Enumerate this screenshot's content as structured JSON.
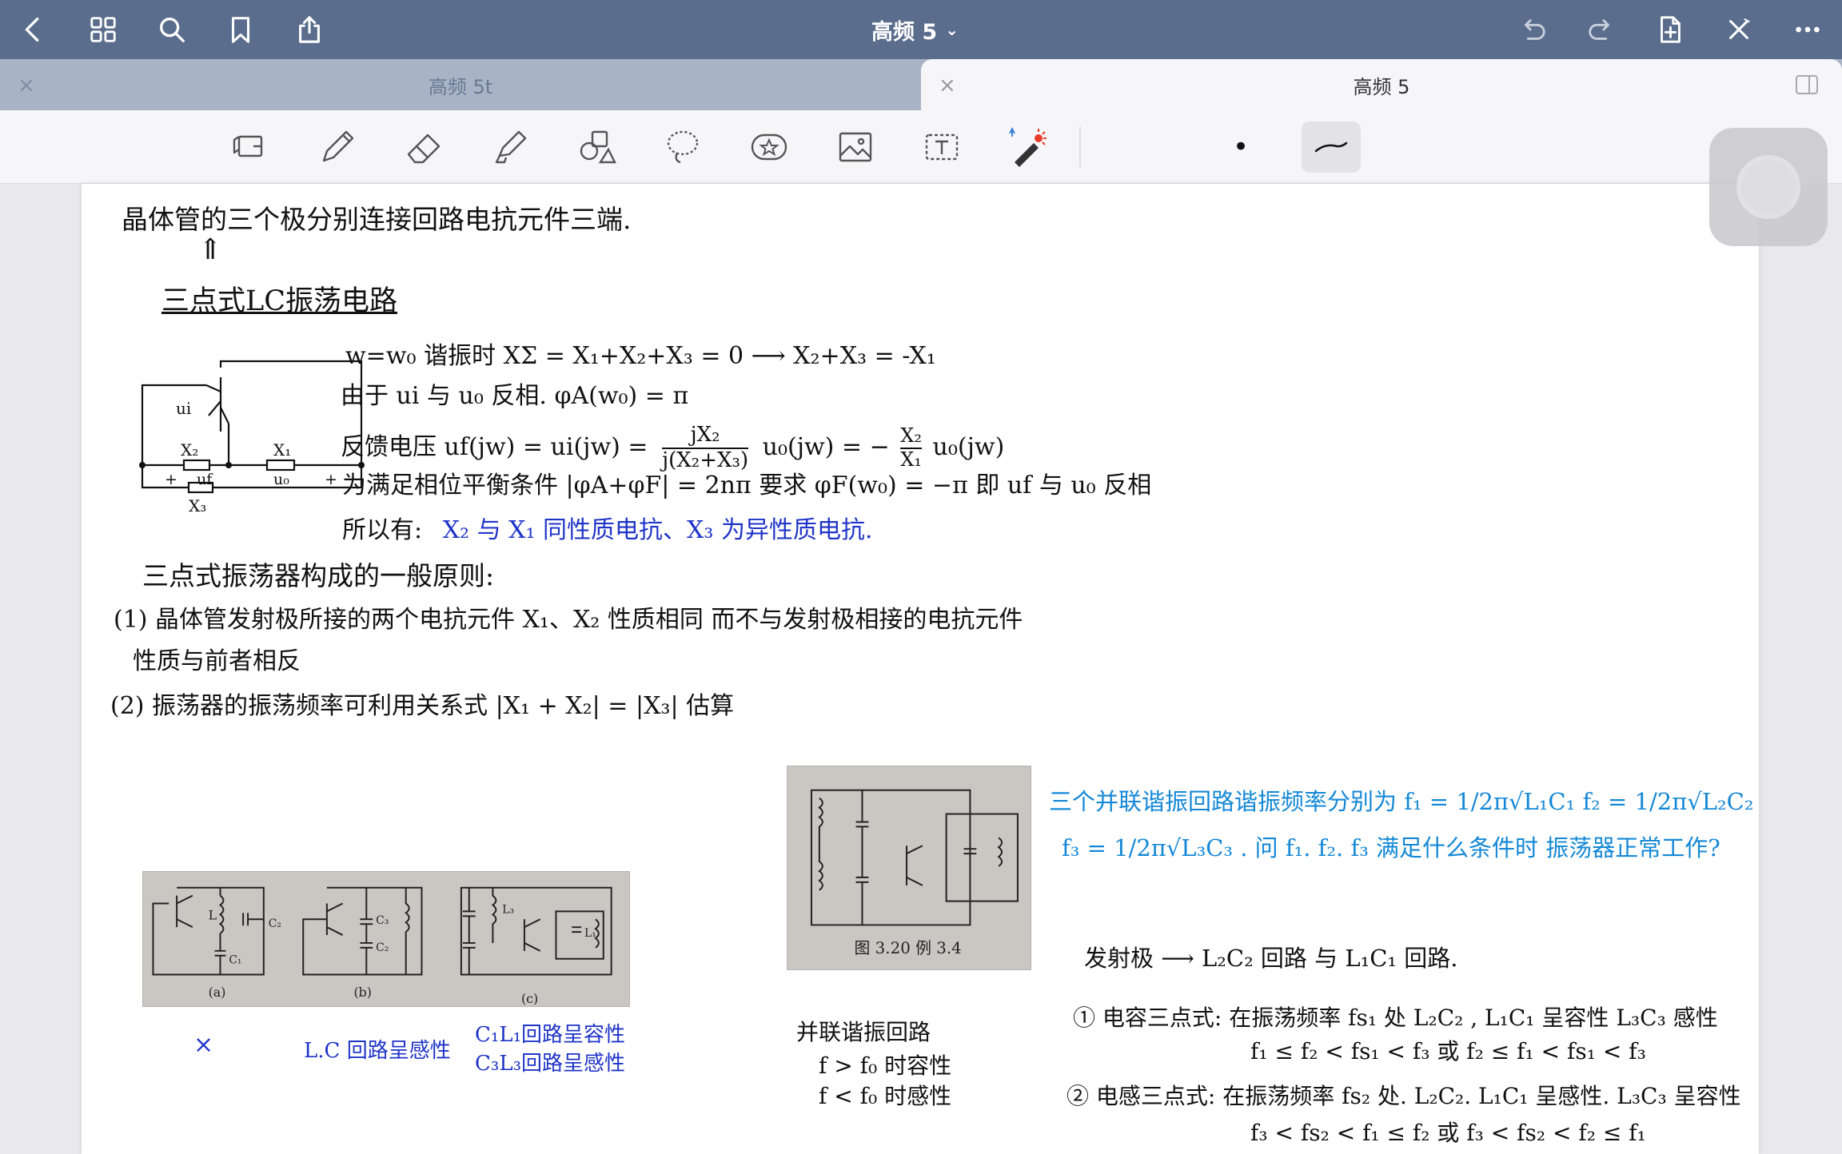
{
  "nav": {
    "title": "高频 5",
    "icons": [
      "back-icon",
      "grid-icon",
      "search-icon",
      "bookmark-icon",
      "share-icon",
      "undo-icon",
      "redo-icon",
      "add-page-icon",
      "close-icon",
      "more-icon"
    ]
  },
  "tabs": [
    {
      "label": "高频 5t",
      "active": false
    },
    {
      "label": "高频 5",
      "active": true
    }
  ],
  "toolbar": {
    "tools": [
      "read-mode",
      "pen",
      "eraser",
      "highlighter",
      "shapes",
      "lasso",
      "sticker",
      "image",
      "text",
      "laser-pointer"
    ],
    "pen_size_dot": "•"
  },
  "notes": {
    "line1": "晶体管的三个极分别连接回路电抗元件三端.",
    "arrow": "⇑",
    "heading1": "三点式LC振荡电路",
    "eq1": "w=w₀ 谐振时 XΣ = X₁+X₂+X₃ = 0  ⟶  X₂+X₃ = -X₁",
    "eq2": "由于 ui 与 u₀ 反相. φA(w₀) = π",
    "eq3_a": "反馈电压  uf(jw) = ui(jw) =",
    "eq3_frac_num": "jX₂",
    "eq3_frac_den": "j(X₂+X₃)",
    "eq3_b": "u₀(jw) = −",
    "eq3_frac2_num": "X₂",
    "eq3_frac2_den": "X₁",
    "eq3_c": "u₀(jw)",
    "eq4": "为满足相位平衡条件 |φA+φF| = 2nπ  要求 φF(w₀) = −π  即 uf 与 u₀ 反相",
    "eq5_a": "所以有:",
    "eq5_b": "X₂ 与 X₁ 同性质电抗、X₃ 为异性质电抗.",
    "heading2": "三点式振荡器构成的一般原则:",
    "rule1a": "(1) 晶体管发射极所接的两个电抗元件 X₁、X₂ 性质相同  而不与发射极相接的电抗元件",
    "rule1b": "性质与前者相反",
    "rule2": "(2) 振荡器的振荡频率可利用关系式  |X₁ + X₂| = |X₃|  估算",
    "circuit_labels": {
      "ui": "ui",
      "x2": "X₂",
      "x1": "X₁",
      "x3": "X₃",
      "uf": "uf",
      "u0": "u₀"
    },
    "fig_captions": [
      "(a)",
      "(b)",
      "(c)"
    ],
    "fig_label_L": "L",
    "fig_label_C1": "C₁",
    "fig_label_C2": "C₂",
    "fig_label_C3": "C₃",
    "fig_label_L1": "L₁",
    "fig_label_L3": "L₃",
    "ans_a": "×",
    "ans_b": "L.C 回路呈感性",
    "ans_c1": "C₁L₁回路呈容性",
    "ans_c2": "C₃L₃回路呈感性",
    "fig2_caption": "图 3.20   例 3.4",
    "parallel_1": "并联谐振回路",
    "parallel_2": "f > f₀ 时容性",
    "parallel_3": "f < f₀ 时感性",
    "q_line1": "三个并联谐振回路谐振频率分别为 f₁ = 1/2π√L₁C₁   f₂ = 1/2π√L₂C₂",
    "q_line2": "f₃ = 1/2π√L₃C₃ .   问 f₁. f₂. f₃ 满足什么条件时 振荡器正常工作?",
    "sol_line1": "发射极 ⟶ L₂C₂ 回路 与 L₁C₁ 回路.",
    "sol_line2": "① 电容三点式: 在振荡频率 fs₁ 处  L₂C₂ , L₁C₁ 呈容性  L₃C₃ 感性",
    "sol_line3": "f₁ ≤ f₂ < fs₁ < f₃   或  f₂ ≤ f₁ < fs₁ < f₃",
    "sol_line4": "② 电感三点式: 在振荡频率 fs₂ 处. L₂C₂. L₁C₁ 呈感性. L₃C₃ 呈容性",
    "sol_line5": "f₃ < fs₂ < f₁ ≤ f₂   或  f₃ < fs₂ < f₂ ≤ f₁"
  }
}
